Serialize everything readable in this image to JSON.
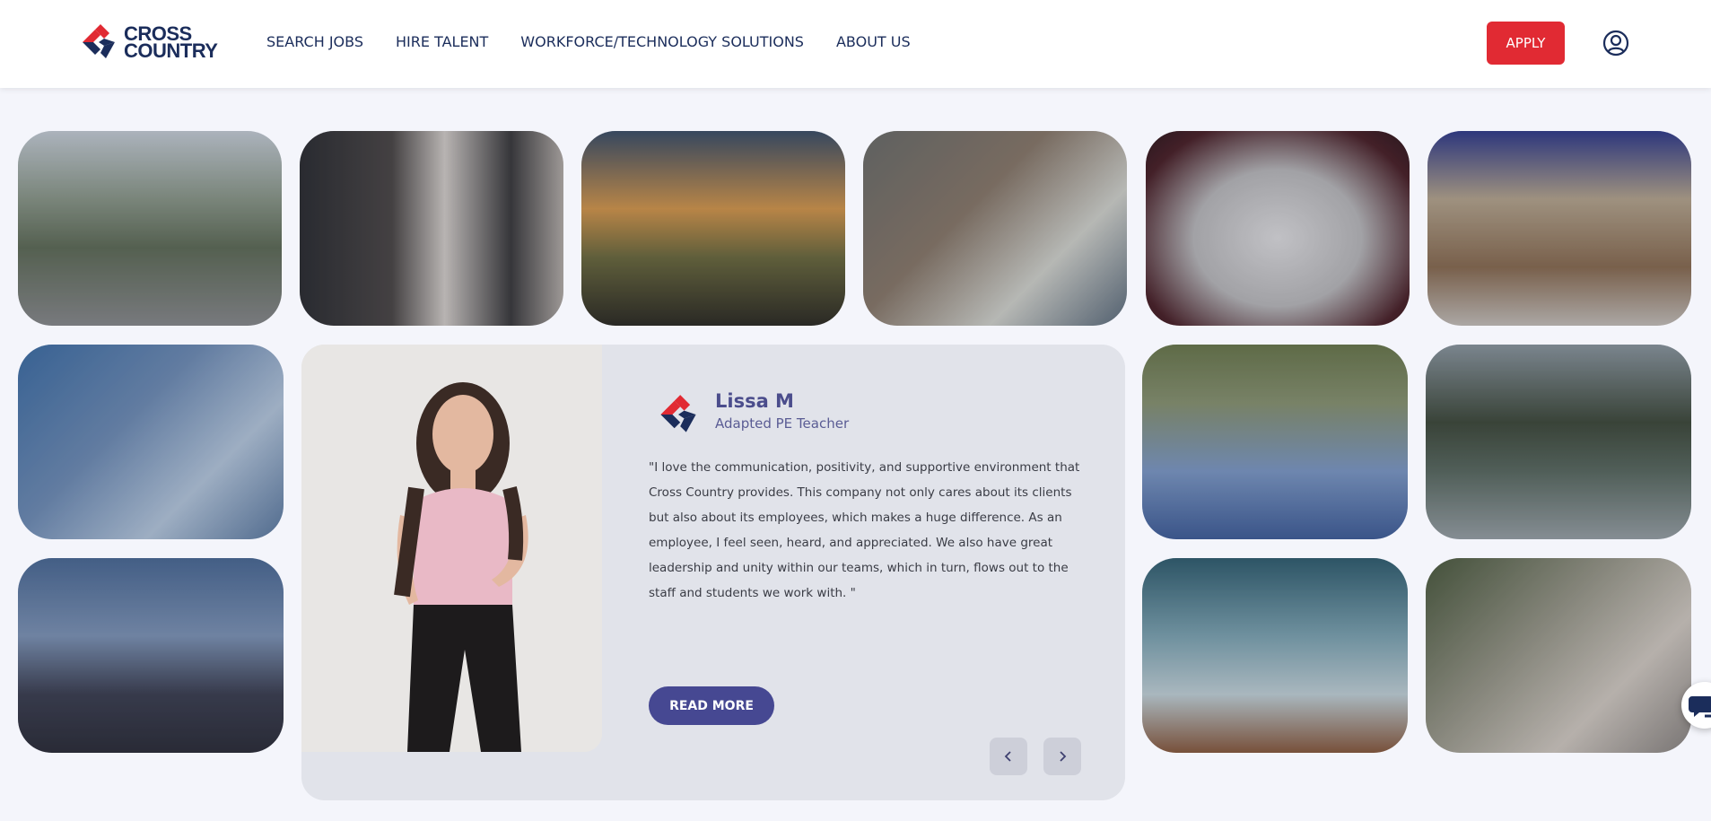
{
  "header": {
    "logo_line1": "CROSS",
    "logo_line2": "COUNTRY",
    "nav": [
      "SEARCH JOBS",
      "HIRE TALENT",
      "WORKFORCE/TECHNOLOGY SOLUTIONS",
      "ABOUT US"
    ],
    "apply_label": "APPLY",
    "user_icon": "user-circle-icon"
  },
  "testimonial": {
    "name": "Lissa M",
    "role": "Adapted PE Teacher",
    "quote": "\"I love the communication, positivity, and supportive environment that Cross Country provides. This company not only cares about its clients but also about its employees, which makes a huge difference. As an employee, I feel seen, heard, and appreciated. We also have great leadership and unity within our teams, which in turn, flows out to the staff and students we work with. \"",
    "read_more_label": "READ MORE",
    "prev_icon": "chevron-left-icon",
    "next_icon": "chevron-right-icon"
  },
  "chat_icon": "chat-bubbles-icon",
  "colors": {
    "brand_navy": "#1b2d5b",
    "brand_red": "#e12a33",
    "accent_purple": "#464892",
    "page_bg": "#f4f5fb"
  }
}
